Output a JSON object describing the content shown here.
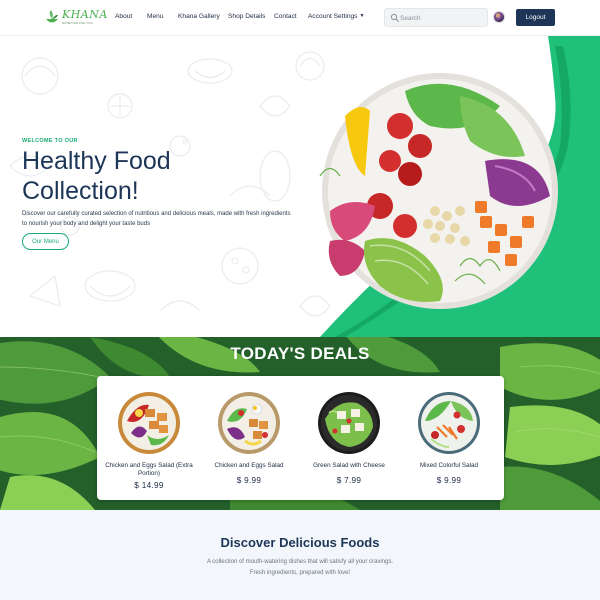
{
  "brand": {
    "name": "KHANA",
    "tagline": "NUTRITION FOR YOU"
  },
  "nav": {
    "items": [
      {
        "label": "About"
      },
      {
        "label": "Menu"
      },
      {
        "label": "Khana Gallery"
      },
      {
        "label": "Shop Details"
      },
      {
        "label": "Contact"
      },
      {
        "label": "Account Settings"
      }
    ],
    "search_placeholder": "Search",
    "logout_label": "Logout"
  },
  "hero": {
    "kicker": "WELCOME TO OUR",
    "title": "Healthy Food Collection!",
    "description": "Discover our carefully curated selection of nutritious and delicious meals, made with fresh ingredients to nourish your body and delight your taste buds",
    "button_label": "Our Menu"
  },
  "deals": {
    "title": "TODAY'S DEALS",
    "items": [
      {
        "name": "Chicken and Eggs Salad (Extra Portion)",
        "price": "$ 14.99"
      },
      {
        "name": "Chicken and Eggs Salad",
        "price": "$ 9.99"
      },
      {
        "name": "Green Salad with Cheese",
        "price": "$ 7.99"
      },
      {
        "name": "Mixed Colorful Salad",
        "price": "$ 9.99"
      }
    ]
  },
  "discover": {
    "title": "Discover Delicious Foods",
    "line1": "A collection of mouth-watering dishes that will satisfy all your cravings.",
    "line2": "Fresh ingredients, prepared with love!"
  },
  "colors": {
    "brand_navy": "#1d3557",
    "accent_green": "#1aab72",
    "logo_green": "#4caf50"
  },
  "icons": {
    "search": "search-icon",
    "dropdown": "chevron-down-icon",
    "logo": "leaf-bowl-icon"
  }
}
